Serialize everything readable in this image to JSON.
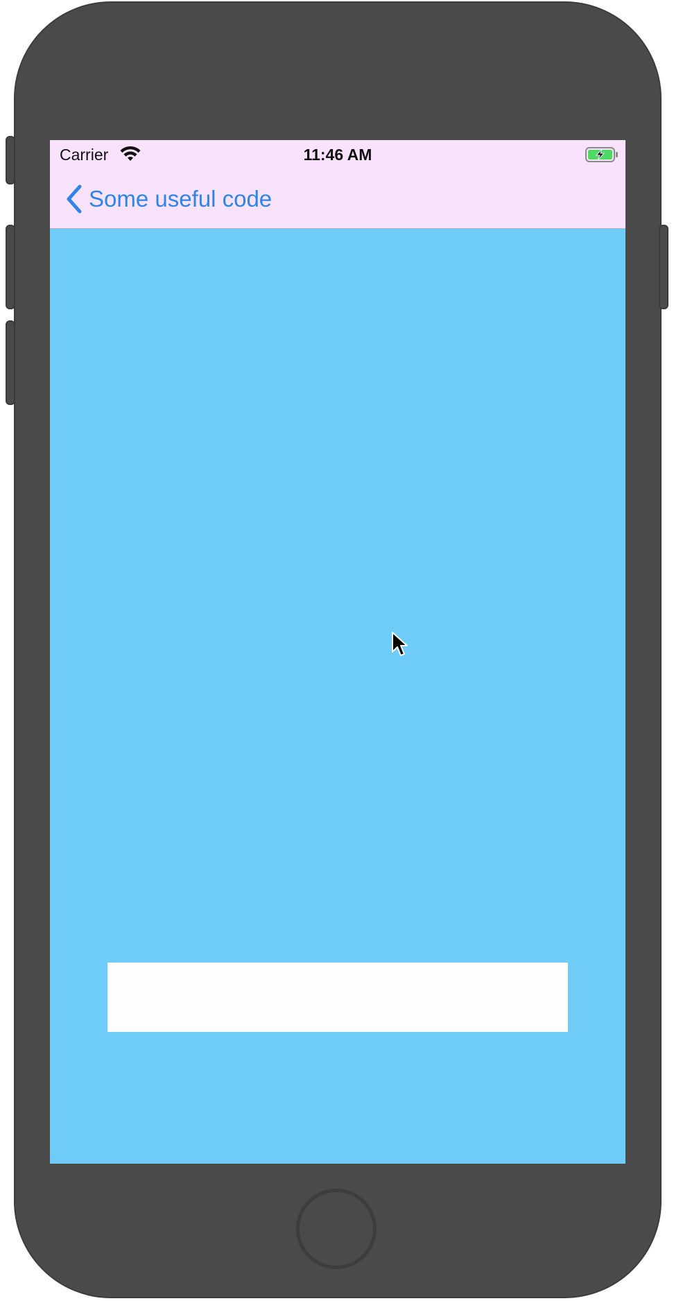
{
  "status_bar": {
    "carrier": "Carrier",
    "time": "11:46 AM",
    "wifi_icon": "wifi-icon",
    "battery_icon": "battery-charging-icon"
  },
  "navbar": {
    "back_icon": "chevron-left-icon",
    "back_label": "Some useful code"
  },
  "content": {
    "text_field": {
      "value": "",
      "placeholder": ""
    }
  },
  "colors": {
    "navbar_background": "#f9e3fc",
    "content_background": "#6fcbf8",
    "accent": "#2f84e8",
    "battery_fill": "#4cd964",
    "device_frame": "#4a4a4a"
  }
}
